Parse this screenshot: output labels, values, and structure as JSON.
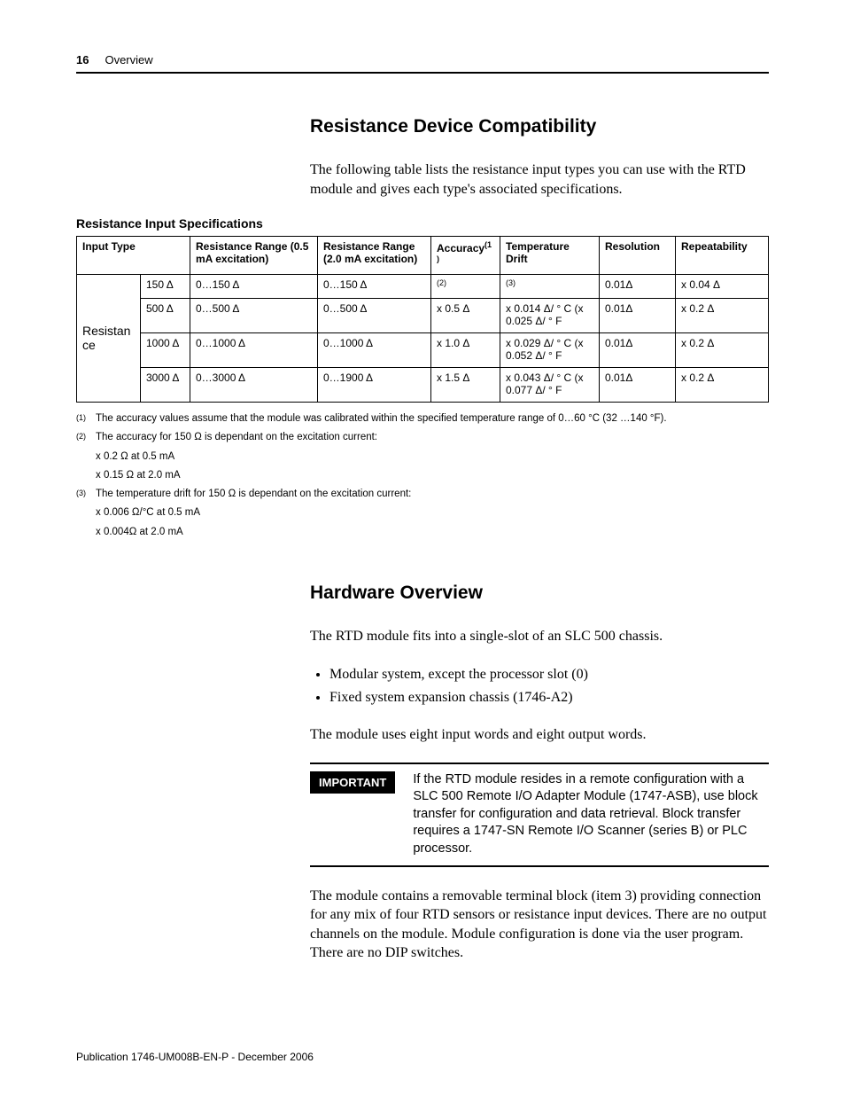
{
  "header": {
    "page_number": "16",
    "section": "Overview"
  },
  "section1": {
    "heading": "Resistance Device Compatibility",
    "intro": "The following table lists the resistance input types you can use with the RTD module and gives each type's associated specifications.",
    "table_title": "Resistance Input Specifications",
    "columns": {
      "input_type": "Input Type",
      "range_05": "Resistance Range (0.5 mA excitation)",
      "range_20": "Resistance Range (2.0 mA excitation)",
      "accuracy": "Accuracy",
      "accuracy_sup": "(1)",
      "temp_drift": "Temperature Drift",
      "resolution": "Resolution",
      "repeatability": "Repeatability"
    },
    "row_group_label": "Resistance",
    "rows": [
      {
        "type": "150 Δ",
        "r05": "0…150 Δ",
        "r20": "0…150 Δ",
        "accuracy": "(2)",
        "drift": "(3)",
        "resolution": "0.01Δ",
        "repeat": "x 0.04 Δ"
      },
      {
        "type": "500 Δ",
        "r05": "0…500 Δ",
        "r20": "0…500 Δ",
        "accuracy": "x 0.5 Δ",
        "drift": "x 0.014 Δ/ ° C (x 0.025 Δ/ ° F",
        "resolution": "0.01Δ",
        "repeat": "x 0.2 Δ"
      },
      {
        "type": "1000 Δ",
        "r05": "0…1000 Δ",
        "r20": "0…1000 Δ",
        "accuracy": "x 1.0 Δ",
        "drift": "x 0.029 Δ/ ° C (x 0.052 Δ/ ° F",
        "resolution": "0.01Δ",
        "repeat": "x 0.2 Δ"
      },
      {
        "type": "3000 Δ",
        "r05": "0…3000 Δ",
        "r20": "0…1900 Δ",
        "accuracy": "x 1.5 Δ",
        "drift": "x 0.043 Δ/ ° C (x 0.077 Δ/ ° F",
        "resolution": "0.01Δ",
        "repeat": "x 0.2 Δ"
      }
    ],
    "footnotes": {
      "f1_mark": "(1)",
      "f1": "The accuracy values assume that the module was calibrated within the specified temperature range of 0…60 °C (32 …140 °F).",
      "f2_mark": "(2)",
      "f2": "The accuracy for 150 Ω is dependant on the excitation current:",
      "f2a": "x 0.2 Ω at 0.5 mA",
      "f2b": "x 0.15 Ω at 2.0 mA",
      "f3_mark": "(3)",
      "f3": "The temperature drift for 150 Ω is dependant on the excitation current:",
      "f3a": "x 0.006 Ω/°C at 0.5 mA",
      "f3b": "x 0.004Ω at 2.0 mA"
    }
  },
  "section2": {
    "heading": "Hardware Overview",
    "p1": "The RTD module fits into a single-slot of an SLC 500 chassis.",
    "bullets": [
      "Modular system, except the processor slot (0)",
      "Fixed system expansion chassis (1746-A2)"
    ],
    "p2": "The module uses eight input words and eight output words.",
    "important_label": "IMPORTANT",
    "important_text": "If the RTD module resides in a remote configuration with a SLC 500 Remote I/O Adapter Module (1747-ASB), use block transfer for configuration and data retrieval. Block transfer requires a 1747-SN Remote I/O Scanner (series B) or PLC processor.",
    "p3": "The module contains a removable terminal block (item 3) providing connection for any mix of four RTD sensors or resistance input devices. There are no output channels on the module. Module configuration is done via the user program. There are no DIP switches."
  },
  "footer": {
    "publication": "Publication 1746-UM008B-EN-P - December 2006"
  }
}
